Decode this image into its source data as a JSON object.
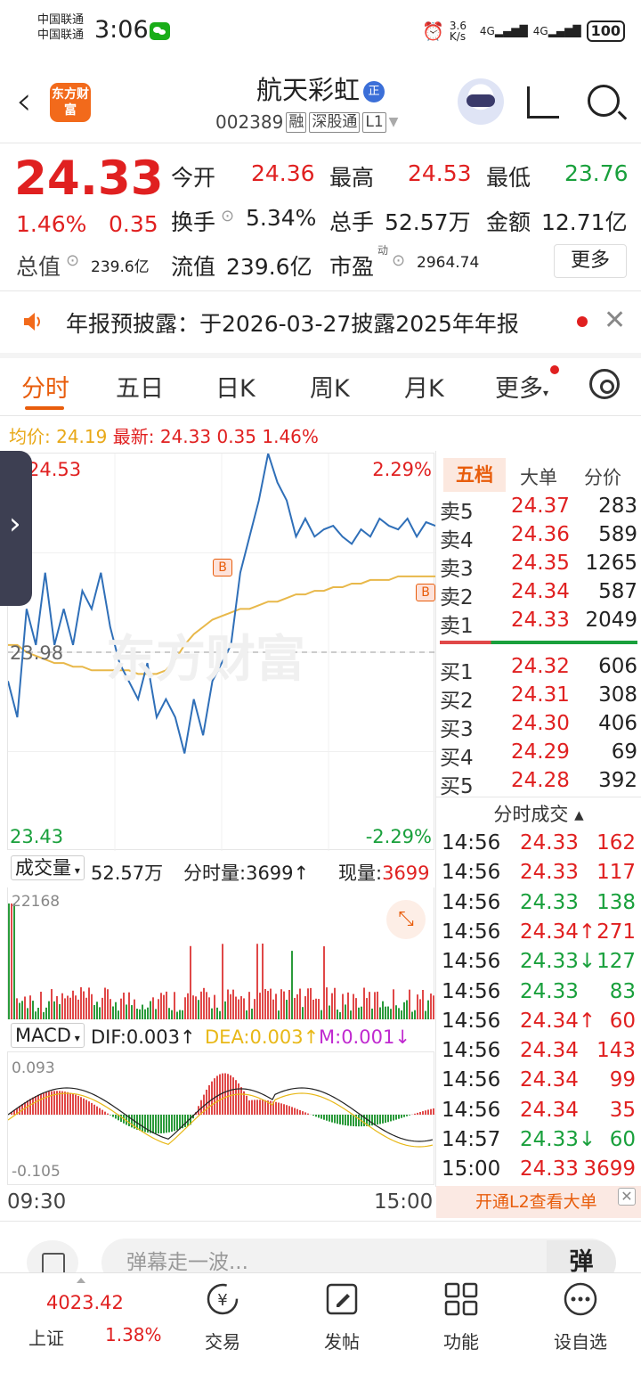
{
  "status_bar": {
    "carrier1": "中国联通",
    "carrier2": "中国联通",
    "time": "3:06",
    "net_speed": "3.6 K/s",
    "net1": "4G",
    "net2": "4G",
    "battery": "100"
  },
  "header": {
    "logo_text": "东方财富",
    "title": "航天彩虹",
    "badge": "正",
    "code": "002389",
    "tags": [
      "融",
      "深股通",
      "L1"
    ]
  },
  "quote": {
    "price": "24.33",
    "pct": "1.46%",
    "change": "0.35",
    "open_label": "今开",
    "open": "24.36",
    "high_label": "最高",
    "high": "24.53",
    "low_label": "最低",
    "low": "23.76",
    "turnover_label": "换手",
    "turnover": "5.34%",
    "volume_label": "总手",
    "volume": "52.57万",
    "amount_label": "金额",
    "amount": "12.71亿",
    "total_cap_label": "总值",
    "total_cap": "239.6亿",
    "float_cap_label": "流值",
    "float_cap": "239.6亿",
    "pe_label": "市盈",
    "pe_sup": "动",
    "pe": "2964.74",
    "more": "更多"
  },
  "notice": {
    "text": "年报预披露：于2026-03-27披露2025年年报"
  },
  "tabs": [
    "分时",
    "五日",
    "日K",
    "周K",
    "月K",
    "更多"
  ],
  "avg_line": {
    "avg_label": "均价:",
    "avg": "24.19",
    "last_label": "最新:",
    "last": "24.33",
    "chg": "0.35",
    "pct": "1.46%"
  },
  "chart": {
    "y_top": "24.53",
    "y_mid": "23.98",
    "y_bottom": "23.43",
    "pct_top": "2.29%",
    "pct_bottom": "-2.29%",
    "watermark": "东方财富",
    "signals": [
      "B",
      "B"
    ],
    "time_start": "09:30",
    "time_end": "15:00"
  },
  "chart_data": {
    "type": "line",
    "ylim": [
      23.43,
      24.53
    ],
    "prev_close": 23.98,
    "price_series": [
      23.9,
      23.8,
      24.1,
      24.0,
      24.2,
      24.0,
      24.1,
      24.0,
      24.15,
      24.1,
      24.2,
      24.05,
      23.95,
      23.9,
      23.85,
      23.95,
      23.8,
      23.85,
      23.8,
      23.7,
      23.85,
      23.75,
      23.9,
      23.95,
      24.0,
      24.2,
      24.3,
      24.4,
      24.53,
      24.45,
      24.4,
      24.3,
      24.35,
      24.3,
      24.32,
      24.33,
      24.3,
      24.28,
      24.32,
      24.3,
      24.35,
      24.33,
      24.32,
      24.35,
      24.3,
      24.34,
      24.33
    ],
    "avg_series": [
      24.0,
      24.0,
      23.98,
      23.97,
      23.96,
      23.95,
      23.95,
      23.94,
      23.94,
      23.93,
      23.93,
      23.93,
      23.93,
      23.93,
      23.92,
      23.92,
      23.92,
      23.93,
      23.96,
      24.0,
      24.03,
      24.05,
      24.07,
      24.08,
      24.09,
      24.1,
      24.1,
      24.11,
      24.12,
      24.12,
      24.13,
      24.14,
      24.14,
      24.15,
      24.15,
      24.16,
      24.16,
      24.17,
      24.17,
      24.18,
      24.18,
      24.18,
      24.19,
      24.19,
      24.19,
      24.19,
      24.19
    ]
  },
  "volume": {
    "label": "成交量",
    "total": "52.57万",
    "tick_label": "分时量:",
    "tick": "3699",
    "now_label": "现量:",
    "now": "3699",
    "max": "22168"
  },
  "macd": {
    "label": "MACD",
    "dif": "DIF:0.003",
    "dea": "DEA:0.003",
    "m": "M:0.001",
    "top": "0.093",
    "bottom": "-0.105"
  },
  "orderbook": {
    "tabs": [
      "五档",
      "大单",
      "分价"
    ],
    "asks": [
      {
        "n": "卖5",
        "p": "24.37",
        "v": "283"
      },
      {
        "n": "卖4",
        "p": "24.36",
        "v": "589"
      },
      {
        "n": "卖3",
        "p": "24.35",
        "v": "1265"
      },
      {
        "n": "卖2",
        "p": "24.34",
        "v": "587"
      },
      {
        "n": "卖1",
        "p": "24.33",
        "v": "2049"
      }
    ],
    "bids": [
      {
        "n": "买1",
        "p": "24.32",
        "v": "606"
      },
      {
        "n": "买2",
        "p": "24.31",
        "v": "308"
      },
      {
        "n": "买3",
        "p": "24.30",
        "v": "406"
      },
      {
        "n": "买4",
        "p": "24.29",
        "v": "69"
      },
      {
        "n": "买5",
        "p": "24.28",
        "v": "392"
      }
    ],
    "trades_title": "分时成交",
    "trades": [
      {
        "t": "14:56",
        "p": "24.33",
        "v": "162",
        "c": "red",
        "a": ""
      },
      {
        "t": "14:56",
        "p": "24.33",
        "v": "117",
        "c": "red",
        "a": ""
      },
      {
        "t": "14:56",
        "p": "24.33",
        "v": "138",
        "c": "green",
        "a": ""
      },
      {
        "t": "14:56",
        "p": "24.34",
        "v": "271",
        "c": "red",
        "a": "↑"
      },
      {
        "t": "14:56",
        "p": "24.33",
        "v": "127",
        "c": "green",
        "a": "↓"
      },
      {
        "t": "14:56",
        "p": "24.33",
        "v": "83",
        "c": "green",
        "a": ""
      },
      {
        "t": "14:56",
        "p": "24.34",
        "v": "60",
        "c": "red",
        "a": "↑"
      },
      {
        "t": "14:56",
        "p": "24.34",
        "v": "143",
        "c": "red",
        "a": ""
      },
      {
        "t": "14:56",
        "p": "24.34",
        "v": "99",
        "c": "red",
        "a": ""
      },
      {
        "t": "14:56",
        "p": "24.34",
        "v": "35",
        "c": "red",
        "a": ""
      },
      {
        "t": "14:57",
        "p": "24.33",
        "v": "60",
        "c": "green",
        "a": "↓"
      },
      {
        "t": "15:00",
        "p": "24.33",
        "v": "3699",
        "c": "red",
        "a": ""
      }
    ],
    "l2": "开通L2查看大单"
  },
  "danmu": {
    "placeholder": "弹幕走一波...",
    "button": "弹"
  },
  "bottom": {
    "index_value": "4023.42",
    "index_name": "上证",
    "index_pct": "1.38%",
    "nav": [
      "交易",
      "发帖",
      "功能",
      "设自选"
    ]
  },
  "colors": {
    "up": "#e02020",
    "down": "#19a03c",
    "accent": "#e85d0c",
    "line": "#2f6fb8",
    "avg": "#e8b84a"
  }
}
